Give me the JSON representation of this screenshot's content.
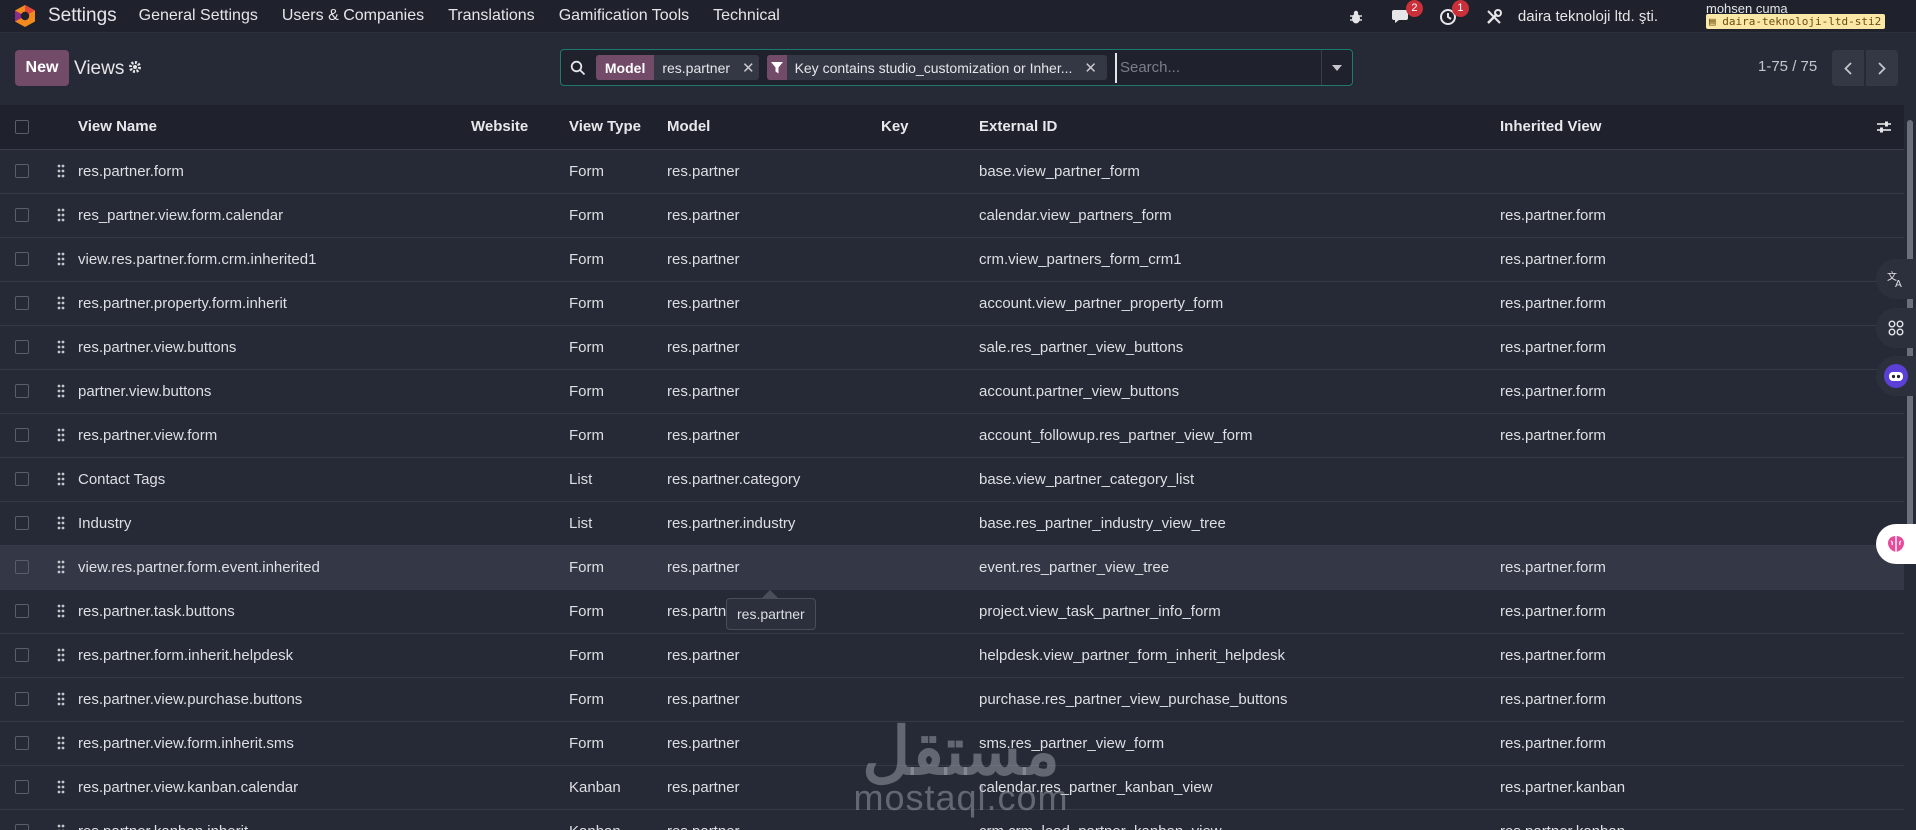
{
  "navbar": {
    "app_name": "Settings",
    "menus": [
      "General Settings",
      "Users & Companies",
      "Translations",
      "Gamification Tools",
      "Technical"
    ],
    "messages_count": "2",
    "activities_count": "1",
    "company": "daira teknoloji ltd. şti.",
    "user_name": "mohsen cuma",
    "database": "daira-teknoloji-ltd-sti2"
  },
  "control_panel": {
    "new_label": "New",
    "breadcrumb": "Views",
    "search": {
      "facets": [
        {
          "label": "Model",
          "value": "res.partner"
        },
        {
          "value": "Key contains studio_customization or Inher..."
        }
      ],
      "placeholder": "Search..."
    },
    "pager": "1-75 / 75"
  },
  "table": {
    "columns": [
      "View Name",
      "Website",
      "View Type",
      "Model",
      "Key",
      "External ID",
      "Inherited View"
    ],
    "rows": [
      {
        "name": "res.partner.form",
        "website": "",
        "type": "Form",
        "model": "res.partner",
        "key": "",
        "external_id": "base.view_partner_form",
        "inherited": ""
      },
      {
        "name": "res_partner.view.form.calendar",
        "website": "",
        "type": "Form",
        "model": "res.partner",
        "key": "",
        "external_id": "calendar.view_partners_form",
        "inherited": "res.partner.form"
      },
      {
        "name": "view.res.partner.form.crm.inherited1",
        "website": "",
        "type": "Form",
        "model": "res.partner",
        "key": "",
        "external_id": "crm.view_partners_form_crm1",
        "inherited": "res.partner.form"
      },
      {
        "name": "res.partner.property.form.inherit",
        "website": "",
        "type": "Form",
        "model": "res.partner",
        "key": "",
        "external_id": "account.view_partner_property_form",
        "inherited": "res.partner.form"
      },
      {
        "name": "res.partner.view.buttons",
        "website": "",
        "type": "Form",
        "model": "res.partner",
        "key": "",
        "external_id": "sale.res_partner_view_buttons",
        "inherited": "res.partner.form"
      },
      {
        "name": "partner.view.buttons",
        "website": "",
        "type": "Form",
        "model": "res.partner",
        "key": "",
        "external_id": "account.partner_view_buttons",
        "inherited": "res.partner.form"
      },
      {
        "name": "res.partner.view.form",
        "website": "",
        "type": "Form",
        "model": "res.partner",
        "key": "",
        "external_id": "account_followup.res_partner_view_form",
        "inherited": "res.partner.form"
      },
      {
        "name": "Contact Tags",
        "website": "",
        "type": "List",
        "model": "res.partner.category",
        "key": "",
        "external_id": "base.view_partner_category_list",
        "inherited": ""
      },
      {
        "name": "Industry",
        "website": "",
        "type": "List",
        "model": "res.partner.industry",
        "key": "",
        "external_id": "base.res_partner_industry_view_tree",
        "inherited": ""
      },
      {
        "name": "view.res.partner.form.event.inherited",
        "website": "",
        "type": "Form",
        "model": "res.partner",
        "key": "",
        "external_id": "event.res_partner_view_tree",
        "inherited": "res.partner.form"
      },
      {
        "name": "res.partner.task.buttons",
        "website": "",
        "type": "Form",
        "model": "res.partner",
        "key": "",
        "external_id": "project.view_task_partner_info_form",
        "inherited": "res.partner.form"
      },
      {
        "name": "res.partner.form.inherit.helpdesk",
        "website": "",
        "type": "Form",
        "model": "res.partner",
        "key": "",
        "external_id": "helpdesk.view_partner_form_inherit_helpdesk",
        "inherited": "res.partner.form"
      },
      {
        "name": "res.partner.view.purchase.buttons",
        "website": "",
        "type": "Form",
        "model": "res.partner",
        "key": "",
        "external_id": "purchase.res_partner_view_purchase_buttons",
        "inherited": "res.partner.form"
      },
      {
        "name": "res.partner.view.form.inherit.sms",
        "website": "",
        "type": "Form",
        "model": "res.partner",
        "key": "",
        "external_id": "sms.res_partner_view_form",
        "inherited": "res.partner.form"
      },
      {
        "name": "res.partner.view.kanban.calendar",
        "website": "",
        "type": "Kanban",
        "model": "res.partner",
        "key": "",
        "external_id": "calendar.res_partner_kanban_view",
        "inherited": "res.partner.kanban"
      },
      {
        "name": "res.partner.kanban.inherit",
        "website": "",
        "type": "Kanban",
        "model": "res.partner",
        "key": "",
        "external_id": "crm.crm_lead_partner_kanban_view",
        "inherited": "res.partner.kanban"
      }
    ],
    "hovered_row": 9
  },
  "tooltip": "res.partner",
  "watermark": {
    "arabic": "مستقل",
    "latin": "mostaql.com"
  },
  "colors": {
    "brand": "#714b67",
    "badge": "#c9303a",
    "search_border": "#1d7a70",
    "background": "#262a36",
    "header_bg": "#1f222c"
  }
}
